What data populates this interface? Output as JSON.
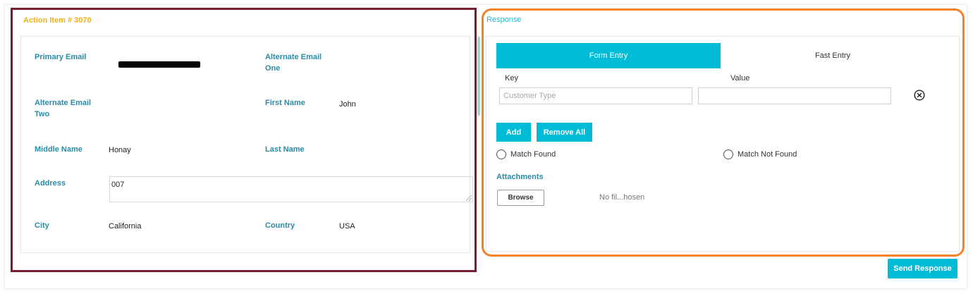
{
  "action_item": {
    "title": "Action Item # 3070",
    "fields": {
      "primary_email": {
        "label": "Primary Email",
        "value": ""
      },
      "alternate_email_one": {
        "label": "Alternate Email One",
        "value": ""
      },
      "alternate_email_two": {
        "label": "Alternate Email Two",
        "value": ""
      },
      "first_name": {
        "label": "First Name",
        "value": "John"
      },
      "middle_name": {
        "label": "Middle Name",
        "value": "Honay"
      },
      "last_name": {
        "label": "Last Name",
        "value": ""
      },
      "address": {
        "label": "Address",
        "value": "007"
      },
      "city": {
        "label": "City",
        "value": "California"
      },
      "country": {
        "label": "Country",
        "value": "USA"
      }
    }
  },
  "response": {
    "title": "Response",
    "tabs": [
      {
        "label": "Form Entry",
        "active": true
      },
      {
        "label": "Fast Entry",
        "active": false
      }
    ],
    "key_header": "Key",
    "value_header": "Value",
    "key_placeholder": "Customer Type",
    "value_placeholder": "",
    "add_label": "Add",
    "remove_all_label": "Remove All",
    "match_found_label": "Match Found",
    "match_not_found_label": "Match Not Found",
    "attachments_label": "Attachments",
    "browse_label": "Browse",
    "file_status": "No fil...hosen",
    "remove_row_icon": "close-circle-icon"
  },
  "send_response_label": "Send Response",
  "colors": {
    "accent": "#00bcd7",
    "label": "#2a8ba8",
    "title": "#f2b01e",
    "left_highlight": "#7a1c31",
    "right_highlight": "#f5822a"
  }
}
